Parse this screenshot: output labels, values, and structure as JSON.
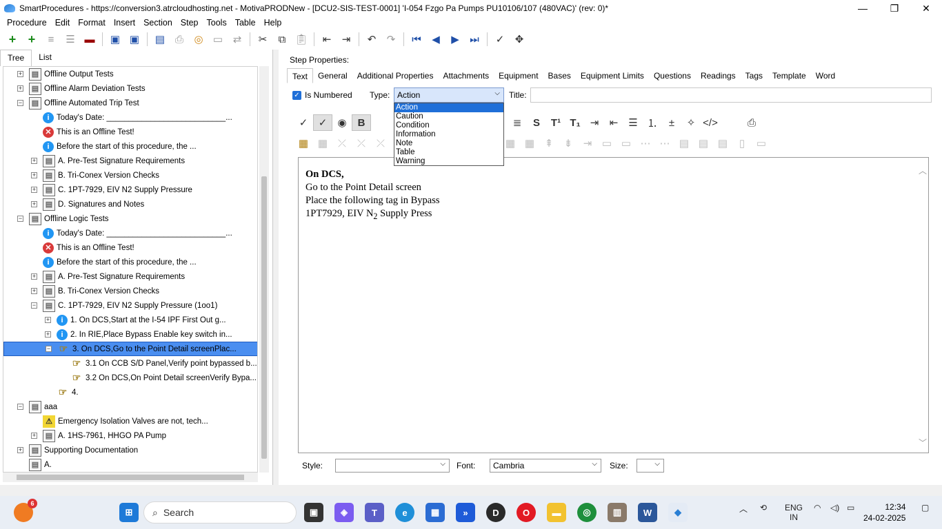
{
  "window": {
    "title": "SmartProcedures - https://conversion3.atrcloudhosting.net - MotivaPRODNew - [DCU2-SIS-TEST-0001] 'I-054 Fzgo Pa Pumps PU10106/107 (480VAC)' (rev: 0)*",
    "minimize": "—",
    "maximize": "❐",
    "close": "✕"
  },
  "menu": [
    "Procedure",
    "Edit",
    "Format",
    "Insert",
    "Section",
    "Step",
    "Tools",
    "Table",
    "Help"
  ],
  "left_tabs": [
    "Tree",
    "List"
  ],
  "tree": [
    {
      "indent": 0,
      "exp": "+",
      "icon": "folder",
      "label": "Offline Output Tests"
    },
    {
      "indent": 0,
      "exp": "+",
      "icon": "folder",
      "label": "Offline Alarm Deviation Tests"
    },
    {
      "indent": 0,
      "exp": "−",
      "icon": "folder",
      "label": "Offline Automated Trip Test"
    },
    {
      "indent": 1,
      "exp": "",
      "icon": "info",
      "label": "Today's Date: ___________________________..."
    },
    {
      "indent": 1,
      "exp": "",
      "icon": "error",
      "label": "This is an Offline Test!"
    },
    {
      "indent": 1,
      "exp": "",
      "icon": "info",
      "label": "Before the start of this procedure, the ..."
    },
    {
      "indent": 1,
      "exp": "+",
      "icon": "folder",
      "label": "A. Pre-Test Signature Requirements"
    },
    {
      "indent": 1,
      "exp": "+",
      "icon": "folder",
      "label": "B. Tri-Conex Version Checks"
    },
    {
      "indent": 1,
      "exp": "+",
      "icon": "folder",
      "label": "C. 1PT-7929, EIV N2 Supply Pressure"
    },
    {
      "indent": 1,
      "exp": "+",
      "icon": "folder",
      "label": "D. Signatures and Notes"
    },
    {
      "indent": 0,
      "exp": "−",
      "icon": "folder",
      "label": "Offline Logic Tests"
    },
    {
      "indent": 1,
      "exp": "",
      "icon": "info",
      "label": "Today's Date: ___________________________..."
    },
    {
      "indent": 1,
      "exp": "",
      "icon": "error",
      "label": "This is an Offline Test!"
    },
    {
      "indent": 1,
      "exp": "",
      "icon": "info",
      "label": "Before the start of this procedure, the ..."
    },
    {
      "indent": 1,
      "exp": "+",
      "icon": "folder",
      "label": "A. Pre-Test Signature Requirements"
    },
    {
      "indent": 1,
      "exp": "+",
      "icon": "folder",
      "label": "B. Tri-Conex Version Checks"
    },
    {
      "indent": 1,
      "exp": "−",
      "icon": "folder",
      "label": "C. 1PT-7929, EIV N2 Supply Pressure (1oo1)"
    },
    {
      "indent": 2,
      "exp": "+",
      "icon": "info",
      "label": "1. On DCS,Start at the I-54 IPF First Out g..."
    },
    {
      "indent": 2,
      "exp": "+",
      "icon": "info",
      "label": "2. In RIE,Place Bypass Enable key switch in..."
    },
    {
      "indent": 2,
      "exp": "−",
      "icon": "hand",
      "label": "3. On DCS,Go to the Point Detail screenPlac...",
      "selected": true
    },
    {
      "indent": 3,
      "exp": "",
      "icon": "hand",
      "label": "3.1 On CCB S/D Panel,Verify point bypassed b..."
    },
    {
      "indent": 3,
      "exp": "",
      "icon": "hand",
      "label": "3.2 On DCS,On Point Detail screenVerify Bypa..."
    },
    {
      "indent": 2,
      "exp": "",
      "icon": "hand",
      "label": "4."
    },
    {
      "indent": 0,
      "exp": "−",
      "icon": "folder",
      "label": "aaa"
    },
    {
      "indent": 1,
      "exp": "",
      "icon": "warn",
      "label": "Emergency Isolation Valves are not, tech..."
    },
    {
      "indent": 1,
      "exp": "+",
      "icon": "folder",
      "label": "A. 1HS-7961, HHGO PA Pump"
    },
    {
      "indent": 0,
      "exp": "+",
      "icon": "folder",
      "label": "Supporting Documentation"
    },
    {
      "indent": 0,
      "exp": "",
      "icon": "folder",
      "label": "A."
    }
  ],
  "step_properties": {
    "title": "Step Properties:"
  },
  "right_tabs": [
    "Text",
    "General",
    "Additional Properties",
    "Attachments",
    "Equipment",
    "Bases",
    "Equipment Limits",
    "Questions",
    "Readings",
    "Tags",
    "Template",
    "Word"
  ],
  "props": {
    "is_numbered": "Is Numbered",
    "type_label": "Type:",
    "type_value": "Action",
    "title_label": "Title:"
  },
  "type_options": [
    "Action",
    "Caution",
    "Condition",
    "Information",
    "Note",
    "Table",
    "Warning"
  ],
  "editor": {
    "line1": "On DCS,",
    "line2": "Go to the Point Detail screen",
    "line3": "Place the following tag in Bypass",
    "line4a": "1PT7929, EIV N",
    "line4sub": "2",
    "line4b": " Supply Press"
  },
  "bottom": {
    "style_label": "Style:",
    "font_label": "Font:",
    "font_value": "Cambria",
    "size_label": "Size:"
  },
  "taskbar": {
    "search": "Search",
    "lang1": "ENG",
    "lang2": "IN",
    "time": "12:34",
    "date": "24-02-2025",
    "badge": "6"
  }
}
